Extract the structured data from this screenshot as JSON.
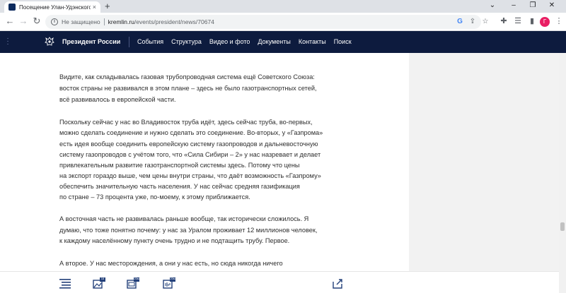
{
  "browser": {
    "tab_title": "Посещение Улан-Удэнского ав",
    "tab_close": "×",
    "new_tab": "+",
    "window_controls": [
      "⌄",
      "–",
      "❐",
      "✕"
    ],
    "nav_buttons": [
      "←",
      "→",
      "↻"
    ],
    "security_icon": "i",
    "security_label": "Не защищено",
    "url_host": "kremlin.ru",
    "url_path": "/events/president/news/70674",
    "omnibox_icons": [
      "google-icon",
      "share-icon",
      "star-icon"
    ],
    "toolbar_icons": [
      "extensions-icon",
      "reading-list-icon",
      "sidepanel-icon",
      "more-icon"
    ],
    "profile_initial": "Г",
    "profile_color": "#e91e63"
  },
  "site": {
    "title": "Президент России",
    "nav": [
      "События",
      "Структура",
      "Видео и фото",
      "Документы",
      "Контакты",
      "Поиск"
    ],
    "header_color": "#0d1b3e"
  },
  "article": {
    "lines": [
      "Видите, как складывалась газовая трубопроводная система ещё Советского Союза:",
      "восток страны не развивался в этом плане – здесь не было газотранспортных сетей,",
      "всё развивалось в европейской части.",
      "Поскольку сейчас у нас во Владивосток труба идёт, здесь сейчас труба, во-первых,",
      "можно сделать соединение и нужно сделать это соединение. Во-вторых, у «Газпрома»",
      "есть идея вообще соединить европейскую систему газопроводов и дальневосточную",
      "систему газопроводов с учётом того, что «Сила Сибири – 2» у нас назревает и делает",
      "привлекательным развитие газотранспортной системы здесь. Потому что цены",
      "на экспорт гораздо выше, чем цены внутри страны, что даёт возможность «Газпрому»",
      "обеспечить значительную часть населения. У нас сейчас средняя газификация",
      "по стране – 73 процента уже, по-моему, к этому приближается.",
      "А восточная часть не развивалась раньше вообще, так исторически сложилось. Я",
      "думаю, что тоже понятно почему: у нас за Уралом проживает 12 миллионов человек,",
      "к каждому населённому пункту очень трудно и не подтащить трубу. Первое.",
      "А второе. У нас месторождения, а они у нас есть, но сюда никогда ничего"
    ]
  },
  "bottom_bar": {
    "icons": [
      "text-icon",
      "photo-icon",
      "video-icon",
      "audio-icon",
      "share-icon"
    ],
    "badges": [
      "18",
      "20м",
      "20м"
    ]
  }
}
